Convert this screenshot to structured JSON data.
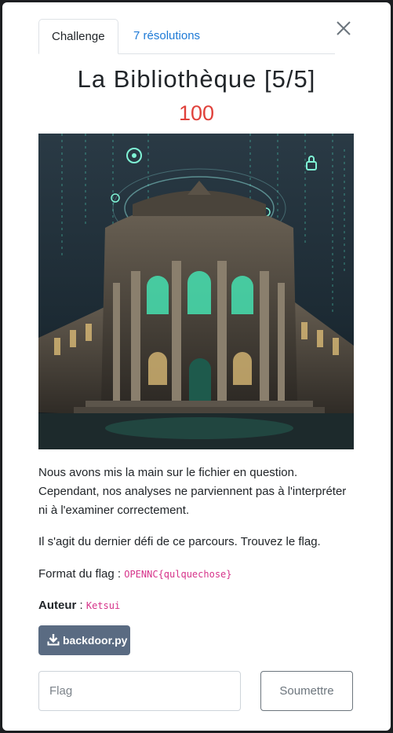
{
  "tabs": [
    {
      "label": "Challenge"
    },
    {
      "label": "7 résolutions"
    }
  ],
  "challenge": {
    "title": "La Bibliothèque [5/5]",
    "points": "100"
  },
  "description": {
    "p1": "Nous avons mis la main sur le fichier en question. Cependant, nos analyses ne parviennent pas à l'interpréter ni à l'examiner correctement.",
    "p2": "Il s'agit du dernier défi de ce parcours. Trouvez le flag.",
    "format_label": "Format du flag : ",
    "format_value": "OPENNC{qulquechose}",
    "author_label": "Auteur",
    "author_sep": " : ",
    "author_value": "Ketsui"
  },
  "download": {
    "label": "backdoor.py"
  },
  "form": {
    "flag_placeholder": "Flag",
    "submit_label": "Soumettre"
  },
  "icons": {
    "close": "close-icon",
    "download": "download-icon"
  }
}
